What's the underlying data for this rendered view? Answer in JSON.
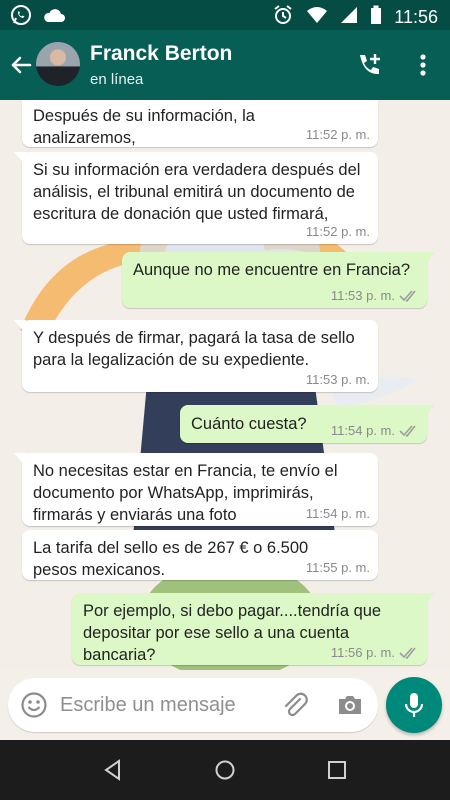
{
  "status_bar": {
    "time": "11:56",
    "icons": [
      "whatsapp-icon",
      "cloud-icon",
      "alarm-icon",
      "wifi-icon",
      "signal-icon",
      "battery-icon"
    ]
  },
  "header": {
    "contact_name": "Franck Berton",
    "contact_status": "en línea",
    "icons": [
      "back-arrow-icon",
      "add-call-icon",
      "more-vert-icon"
    ]
  },
  "messages": [
    {
      "direction": "in",
      "text": "Después de su información, la analizaremos,",
      "time": "11:52 p. m."
    },
    {
      "direction": "in",
      "text": "Si su información era verdadera después del análisis, el tribunal emitirá un documento de escritura de donación que usted firmará,",
      "time": "11:52 p. m."
    },
    {
      "direction": "out",
      "text": "Aunque no me encuentre en Francia?",
      "time": "11:53 p. m.",
      "status": "read"
    },
    {
      "direction": "in",
      "text": "Y después de firmar, pagará la tasa de sello para la legalización de su expediente.",
      "time": "11:53 p. m."
    },
    {
      "direction": "out",
      "text": "Cuánto cuesta?",
      "time": "11:54 p. m.",
      "status": "read"
    },
    {
      "direction": "in",
      "text": "No necesitas estar en Francia, te envío el documento por WhatsApp, imprimirás, firmarás y enviarás una foto",
      "time": "11:54 p. m."
    },
    {
      "direction": "in",
      "text": "La tarifa del sello es de 267 € o 6.500 pesos mexicanos.",
      "time": "11:55 p. m."
    },
    {
      "direction": "out",
      "text": "Por ejemplo, si debo pagar....tendría que depositar por ese sello a una cuenta bancaria?",
      "time": "11:56 p. m.",
      "status": "read"
    }
  ],
  "composer": {
    "placeholder": "Escribe un mensaje",
    "value": "",
    "icons": [
      "emoji-icon",
      "attach-icon",
      "camera-icon",
      "mic-icon"
    ]
  },
  "nav_bar": {
    "icons": [
      "nav-back-icon",
      "nav-home-icon",
      "nav-recents-icon"
    ]
  },
  "colors": {
    "header": "#075e54",
    "status_bar": "#054d44",
    "outgoing_bubble": "#dcf8c6",
    "incoming_bubble": "#ffffff",
    "read_tick": "#9e9e9e",
    "mic_button": "#00897b"
  }
}
